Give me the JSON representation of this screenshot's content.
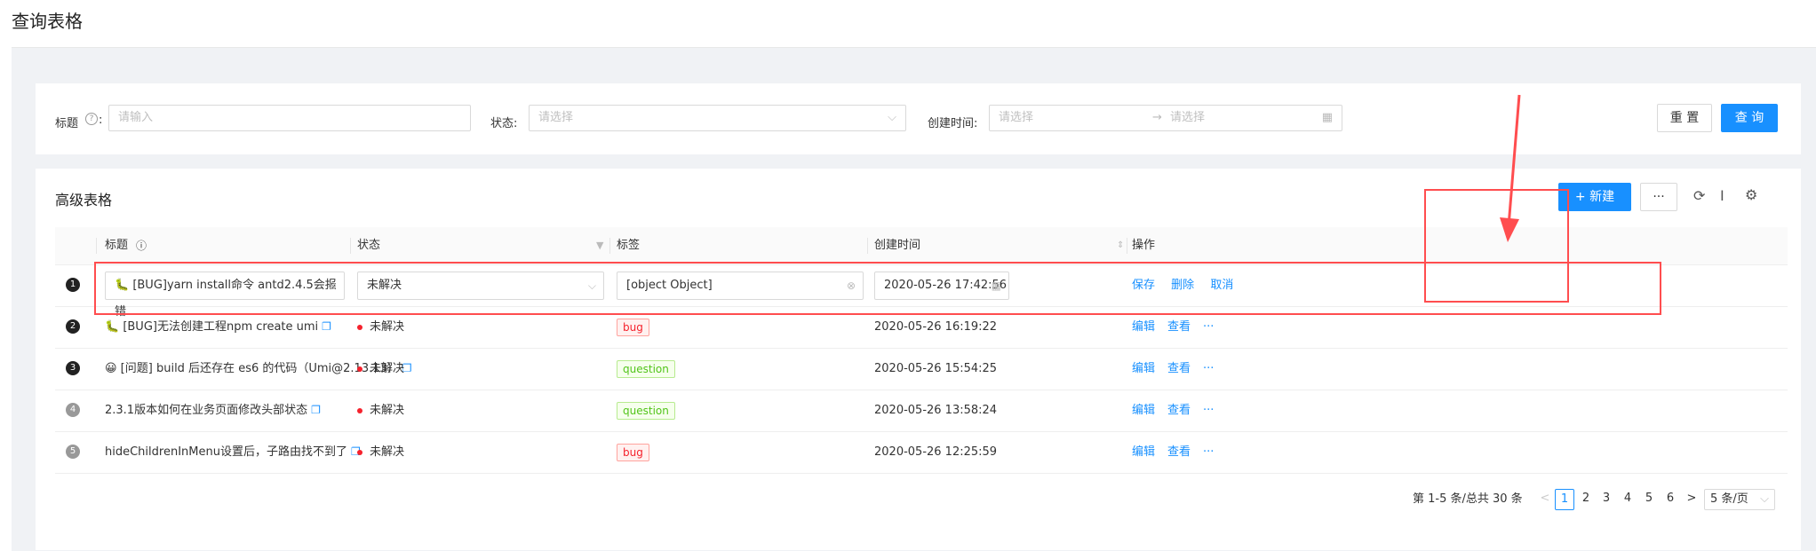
{
  "page": {
    "title": "查询表格"
  },
  "search": {
    "title_label": "标题",
    "title_help": "?",
    "colon": ":",
    "title_placeholder": "请输入",
    "status_label": "状态:",
    "status_placeholder": "请选择",
    "created_label": "创建时间:",
    "start_placeholder": "请选择",
    "range_arrow": "→",
    "end_placeholder": "请选择",
    "reset_label": "重 置",
    "query_label": "查 询"
  },
  "table": {
    "title": "高级表格",
    "new_label": "+ 新建",
    "more_label": "···",
    "columns": {
      "title": "标题",
      "status": "状态",
      "tags": "标签",
      "created": "创建时间",
      "actions": "操作"
    },
    "editing_row": {
      "index": "1",
      "title": "🐛 [BUG]yarn install命令 antd2.4.5会报错",
      "status": "未解决",
      "tag": "[object Object]",
      "created": "2020-05-26 17:42:56",
      "save": "保存",
      "delete": "删除",
      "cancel": "取消"
    },
    "rows": [
      {
        "index": "2",
        "title": "🐛 [BUG]无法创建工程npm create umi",
        "status": "未解决",
        "tag": "bug",
        "created": "2020-05-26 16:19:22"
      },
      {
        "index": "3",
        "title": "😀 [问题] build 后还存在 es6 的代码（Umi@2.13.13）",
        "status": "未解决",
        "tag": "question",
        "created": "2020-05-26 15:54:25"
      },
      {
        "index": "4",
        "title": "2.3.1版本如何在业务页面修改头部状态",
        "status": "未解决",
        "tag": "question",
        "created": "2020-05-26 13:58:24"
      },
      {
        "index": "5",
        "title": "hideChildrenInMenu设置后，子路由找不到了",
        "status": "未解决",
        "tag": "bug",
        "created": "2020-05-26 12:25:59"
      }
    ],
    "row_actions": {
      "edit": "编辑",
      "view": "查看",
      "more": "···"
    },
    "colors": {
      "accent": "#1890ff",
      "danger": "#f5222d",
      "success": "#52c41a",
      "annotation": "#ff4d4f"
    }
  },
  "pagination": {
    "summary": "第 1-5 条/总共 30 条",
    "prev": "<",
    "pages": [
      "1",
      "2",
      "3",
      "4",
      "5",
      "6"
    ],
    "current": "1",
    "next": ">",
    "page_size": "5 条/页"
  }
}
